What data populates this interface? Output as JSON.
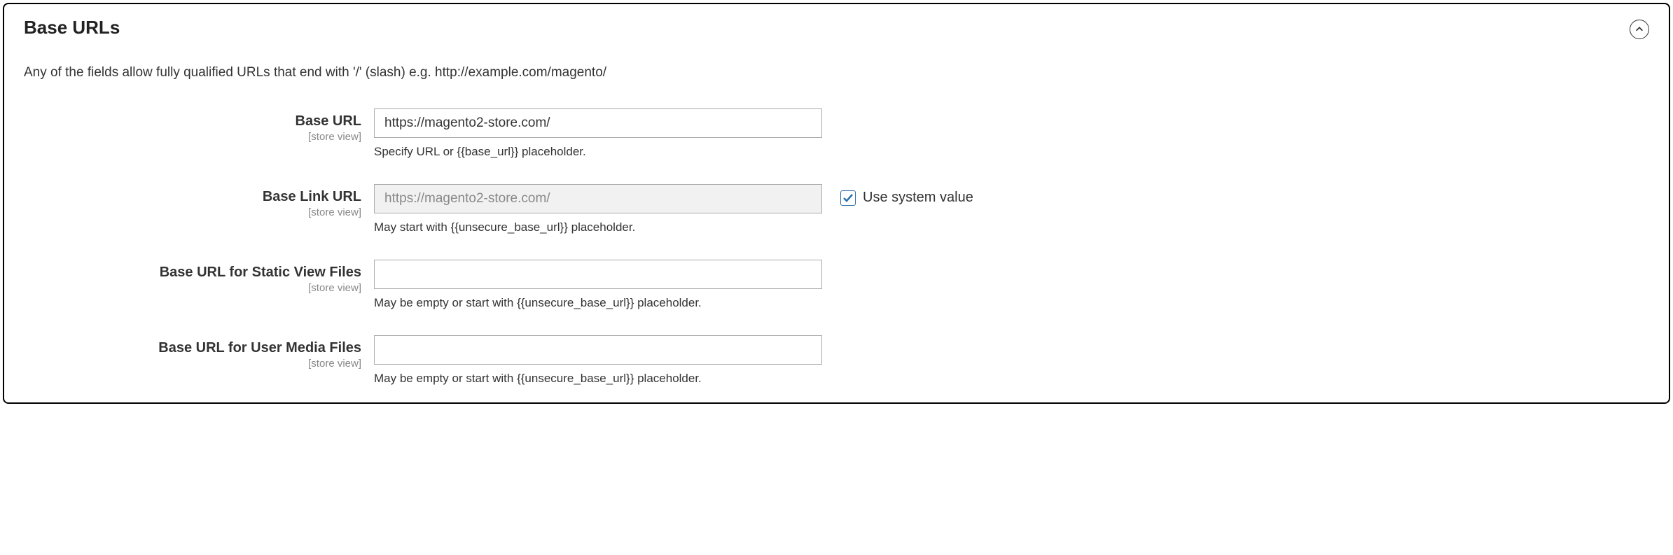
{
  "section": {
    "title": "Base URLs",
    "description": "Any of the fields allow fully qualified URLs that end with '/' (slash) e.g. http://example.com/magento/"
  },
  "scope_label": "[store view]",
  "use_system_value_label": "Use system value",
  "fields": {
    "base_url": {
      "label": "Base URL",
      "value": "https://magento2-store.com/",
      "hint": "Specify URL or {{base_url}} placeholder."
    },
    "base_link_url": {
      "label": "Base Link URL",
      "value": "https://magento2-store.com/",
      "hint": "May start with {{unsecure_base_url}} placeholder.",
      "use_system": true
    },
    "base_url_static": {
      "label": "Base URL for Static View Files",
      "value": "",
      "hint": "May be empty or start with {{unsecure_base_url}} placeholder."
    },
    "base_url_media": {
      "label": "Base URL for User Media Files",
      "value": "",
      "hint": "May be empty or start with {{unsecure_base_url}} placeholder."
    }
  }
}
